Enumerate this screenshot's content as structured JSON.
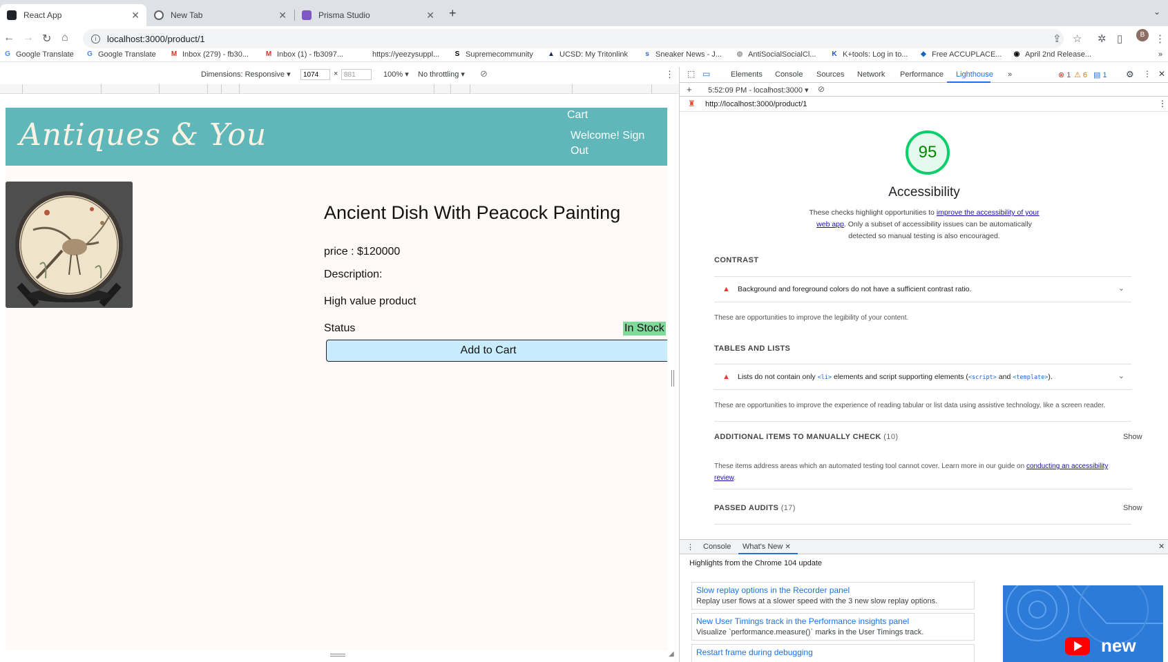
{
  "browser": {
    "tabs": [
      {
        "title": "React App"
      },
      {
        "title": "New Tab"
      },
      {
        "title": "Prisma Studio"
      }
    ],
    "address": "localhost:3000/product/1",
    "avatar_letter": "B",
    "bookmarks": [
      "Google Translate",
      "Google Translate",
      "Inbox (279) - fb30...",
      "Inbox (1) - fb3097...",
      "https://yeezysuppl...",
      "Supremecommunity",
      "UCSD: My Tritonlink",
      "Sneaker News - J...",
      "AntiSocialSocialCl...",
      "K+tools: Log in to...",
      "Free ACCUPLACE...",
      "April 2nd Release..."
    ]
  },
  "device_toolbar": {
    "dimensions": "Dimensions: Responsive",
    "width": "1074",
    "height": "881",
    "zoom": "100%",
    "throttling": "No throttling"
  },
  "site": {
    "title": "Antiques & You",
    "cart": "Cart",
    "welcome": "Welcome! Sign Out"
  },
  "product": {
    "name": "Ancient Dish With Peacock Painting",
    "price": "price : $120000",
    "description_label": "Description:",
    "description": "High value product",
    "status_label": "Status",
    "status_value": "In Stock",
    "add_to_cart": "Add to Cart"
  },
  "devtools": {
    "tabs": [
      "Elements",
      "Console",
      "Sources",
      "Network",
      "Performance",
      "Lighthouse"
    ],
    "selected_tab": "Lighthouse",
    "errors": "1",
    "warnings": "6",
    "messages": "1",
    "report_time": "5:52:09 PM - localhost:3000",
    "report_url": "http://localhost:3000/product/1",
    "score": "95",
    "score_color": "#0cce6b",
    "category": "Accessibility",
    "desc_pre": "These checks highlight opportunities to ",
    "desc_link": "improve the accessibility of your web app",
    "desc_post": ". Only a subset of accessibility issues can be automatically detected so manual testing is also encouraged.",
    "contrast": {
      "head": "CONTRAST",
      "audit": "Background and foreground colors do not have a sufficient contrast ratio.",
      "note": "These are opportunities to improve the legibility of your content."
    },
    "tables": {
      "head": "TABLES AND LISTS",
      "audit_pre": "Lists do not contain only ",
      "audit_code1": "<li>",
      "audit_mid": " elements and script supporting elements (",
      "audit_code2": "<script>",
      "audit_and": " and ",
      "audit_code3": "<template>",
      "audit_post": ").",
      "note": "These are opportunities to improve the experience of reading tabular or list data using assistive technology, like a screen reader."
    },
    "manual": {
      "head": "ADDITIONAL ITEMS TO MANUALLY CHECK",
      "count": "(10)",
      "show": "Show",
      "note_pre": "These items address areas which an automated testing tool cannot cover. Learn more in our guide on ",
      "note_link": "conducting an accessibility review",
      "note_post": "."
    },
    "passed": {
      "head": "PASSED AUDITS",
      "count": "(17)",
      "show": "Show"
    },
    "drawer": {
      "tabs": [
        "Console",
        "What's New"
      ],
      "highlights": "Highlights from the Chrome 104 update",
      "items": [
        {
          "title": "Slow replay options in the Recorder panel",
          "desc": "Replay user flows at a slower speed with the 3 new slow replay options."
        },
        {
          "title": "New User Timings track in the Performance insights panel",
          "desc": "Visualize `performance.measure()` marks in the User Timings track."
        },
        {
          "title": "Restart frame during debugging",
          "desc": ""
        }
      ],
      "video_label": "new"
    }
  }
}
